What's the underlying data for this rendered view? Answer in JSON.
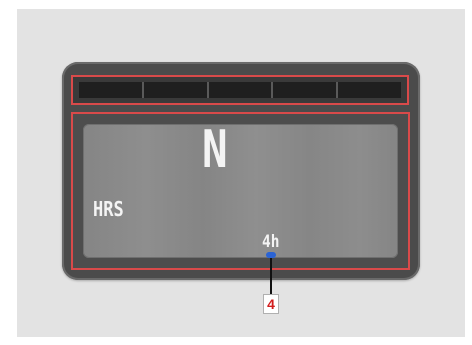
{
  "display": {
    "gear": "N",
    "hours_label": "HRS",
    "hours_value": "4h"
  },
  "callout": {
    "number": "4",
    "color": "#d21d1d"
  },
  "highlight_color": "#d94a4a"
}
